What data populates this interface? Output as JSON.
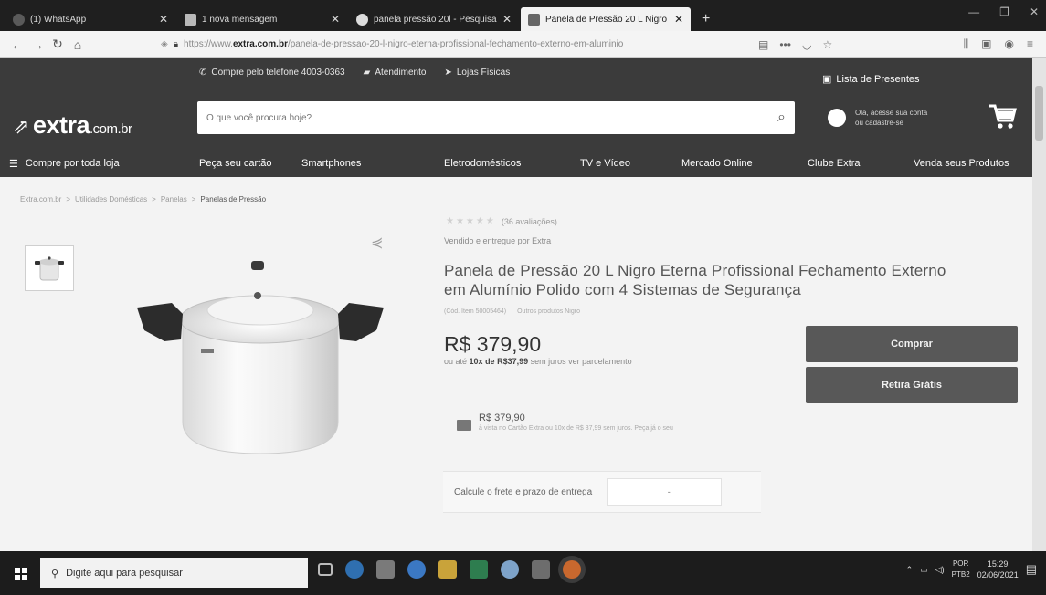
{
  "browser": {
    "tabs": [
      {
        "title": "(1) WhatsApp",
        "favicon_color": "#2e7d32"
      },
      {
        "title": "1 nova mensagem",
        "favicon_color": "#d32f2f"
      },
      {
        "title": "panela pressão 20l - Pesquisa",
        "favicon_color": "#4285f4"
      },
      {
        "title": "Panela de Pressão 20 L Nigro",
        "favicon_color": "#555555"
      }
    ],
    "new_tab": "+",
    "url_prefix": "https://www.",
    "url_domain": "extra.com.br",
    "url_rest": "/panela-de-pressao-20-l-nigro-eterna-profissional-fechamento-externo-em-aluminio",
    "more_icon": "•••"
  },
  "header": {
    "phone": "Compre pelo telefone 4003-0363",
    "support": "Atendimento",
    "stores": "Lojas Físicas",
    "wishlist": "Lista de Presentes",
    "logo_main": "extra",
    "logo_suffix": ".com.br",
    "search_placeholder": "O que você procura hoje?",
    "account_line1": "Olá, acesse sua conta",
    "account_line2": "ou cadastre-se"
  },
  "categories": {
    "all": "Compre por toda loja",
    "items": [
      "Peça seu cartão",
      "Smartphones",
      "Eletrodomésticos",
      "TV e Vídeo",
      "Mercado Online",
      "Clube Extra",
      "Venda seus Produtos"
    ]
  },
  "breadcrumb": [
    "Extra.com.br",
    "Utilidades Domésticas",
    "Panelas",
    "Panelas de Pressão"
  ],
  "product": {
    "reviews": "(36 avaliações)",
    "seller": "Vendido e entregue por Extra",
    "title": "Panela de Pressão 20 L Nigro Eterna Profissional Fechamento Externo em Alumínio Polido com 4 Sistemas de Segurança",
    "code": "(Cód. Item 50005464)",
    "other": "Outros produtos Nigro",
    "price": "R$ 379,90",
    "installments_prefix": "ou até",
    "installments_value": "10x de R$37,99",
    "installments_suffix": "sem juros ver parcelamento",
    "buy": "Comprar",
    "pickup": "Retira Grátis",
    "card_price": "R$ 379,90",
    "card_desc": "à vista no Cartão Extra ou 10x de R$ 37,99 sem juros. Peça já o seu",
    "shipping_label": "Calcule o frete e prazo de entrega",
    "cep_placeholder": "_____-___"
  },
  "taskbar": {
    "search": "Digite aqui para pesquisar",
    "lang1": "POR",
    "lang2": "PTB2",
    "time": "15:29",
    "date": "02/06/2021"
  }
}
